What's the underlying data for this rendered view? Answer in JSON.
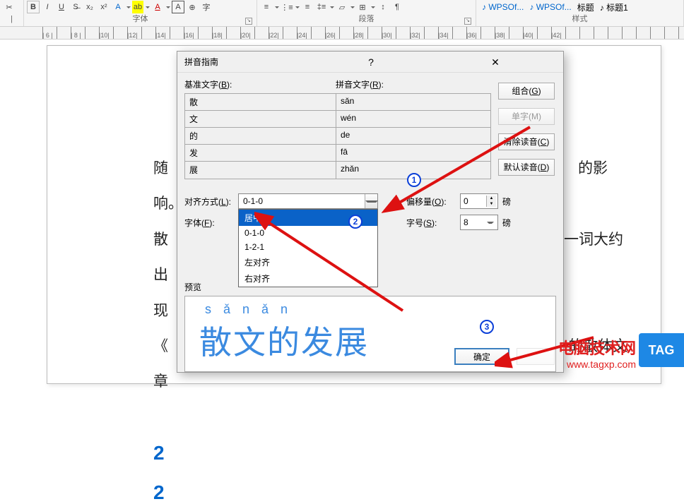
{
  "ribbon": {
    "font_group": "字体",
    "paragraph_group": "段落",
    "styles_group": "样式",
    "style_wps1": "WPSOf...",
    "style_wps2": "WPSOf...",
    "style_title": "标题",
    "style_title1": "标题1"
  },
  "ruler_marks": [
    "6",
    "8",
    "10",
    "12",
    "14",
    "16",
    "18",
    "20",
    "22",
    "24",
    "26",
    "28",
    "30",
    "32",
    "34",
    "36",
    "38",
    "40",
    "42"
  ],
  "document": {
    "line1_left": "随",
    "line1_right": "的影响。",
    "line2_left": "散",
    "line2_right": "一词大约出",
    "line3_left": "现",
    "line4_left": "《",
    "line4_right": "¹的散体文",
    "line5_left": "章",
    "heading_num_a": "2",
    "heading_num_b": "2"
  },
  "dialog": {
    "title": "拼音指南",
    "help": "?",
    "base_label": "基准文字(B):",
    "ruby_label": "拼音文字(R):",
    "rows": [
      {
        "base": "散",
        "ruby": "sǎn"
      },
      {
        "base": "文",
        "ruby": "wén"
      },
      {
        "base": "的",
        "ruby": "de"
      },
      {
        "base": "发",
        "ruby": "fā"
      },
      {
        "base": "展",
        "ruby": "zhǎn"
      }
    ],
    "btn_combine": "组合(G)",
    "btn_single": "单字(M)",
    "btn_clear": "清除读音(C)",
    "btn_default": "默认读音(D)",
    "align_label": "对齐方式(L):",
    "align_value": "0-1-0",
    "align_options": [
      "居中",
      "0-1-0",
      "1-2-1",
      "左对齐",
      "右对齐"
    ],
    "offset_label": "偏移量(O):",
    "offset_value": "0",
    "offset_unit": "磅",
    "font_label": "字体(F):",
    "size_label": "字号(S):",
    "size_value": "8",
    "size_unit": "磅",
    "preview_label": "预览",
    "preview_pinyin": "s  ǎ  n                             ǎ n",
    "preview_hanzi": "散文的发展",
    "btn_ok": "确定"
  },
  "watermark": {
    "title": "电脑技术网",
    "url": "www.tagxp.com"
  },
  "tag": "TAG"
}
